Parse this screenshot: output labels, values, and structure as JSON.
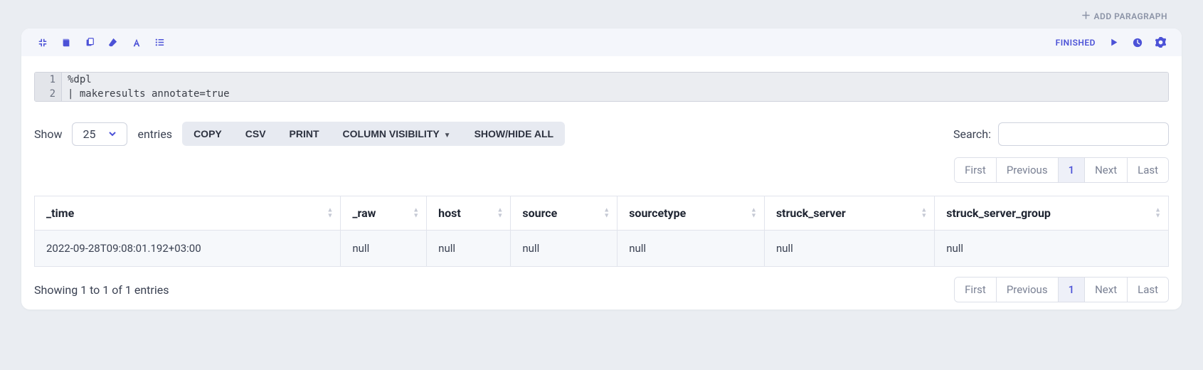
{
  "topbar": {
    "add_paragraph": "ADD PARAGRAPH"
  },
  "header": {
    "status": "FINISHED"
  },
  "code": {
    "line1_no": "1",
    "line2_no": "2",
    "line1": "%dpl",
    "line2": "| makeresults annotate=true"
  },
  "table_control": {
    "show": "Show",
    "page_size": "25",
    "entries": "entries",
    "buttons": {
      "copy": "COPY",
      "csv": "CSV",
      "print": "PRINT",
      "colvis": "COLUMN VISIBILITY",
      "showhide": "SHOW/HIDE ALL"
    },
    "search_label": "Search:"
  },
  "pager": {
    "first": "First",
    "prev": "Previous",
    "page1": "1",
    "next": "Next",
    "last": "Last"
  },
  "table": {
    "headers": {
      "time": "_time",
      "raw": "_raw",
      "host": "host",
      "source": "source",
      "sourcetype": "sourcetype",
      "struck_server": "struck_server",
      "struck_server_group": "struck_server_group"
    },
    "row0": {
      "time": "2022-09-28T09:08:01.192+03:00",
      "raw": "null",
      "host": "null",
      "source": "null",
      "sourcetype": "null",
      "struck_server": "null",
      "struck_server_group": "null"
    }
  },
  "footer": {
    "info": "Showing 1 to 1 of 1 entries"
  }
}
